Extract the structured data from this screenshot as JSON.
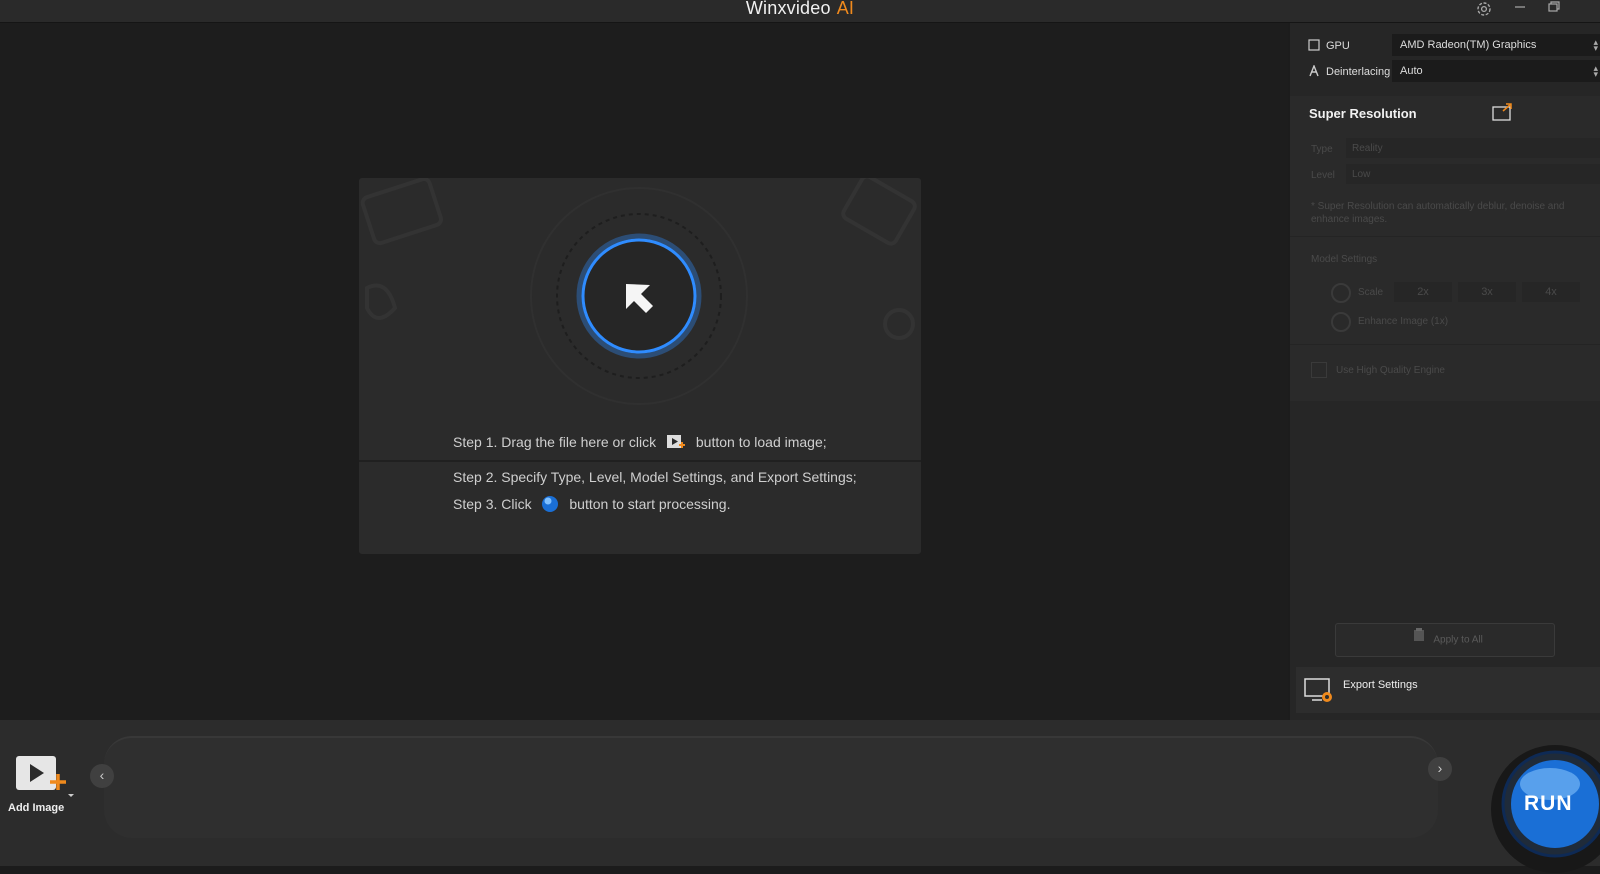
{
  "app": {
    "title": "Winxvideo",
    "title_suffix": "AI"
  },
  "dropzone": {
    "step1_prefix": "Step 1. Drag the file here or click",
    "step1_suffix": "button to load image;",
    "step2": "Step 2. Specify Type, Level, Model Settings, and Export Settings;",
    "step3_prefix": "Step 3. Click",
    "step3_suffix": "button to start processing."
  },
  "right_panel": {
    "gpu": {
      "label": "GPU",
      "value": "AMD Radeon(TM) Graphics"
    },
    "deinterlacing": {
      "label": "Deinterlacing",
      "value": "Auto"
    },
    "super_resolution": {
      "title": "Super Resolution",
      "type_label": "Type",
      "type_value": "Reality",
      "level_label": "Level",
      "level_value": "Low",
      "note": "* Super Resolution can automatically deblur, denoise and enhance images.",
      "model_settings_label": "Model Settings",
      "scale_label": "Scale",
      "scale_options": [
        "2x",
        "3x",
        "4x"
      ],
      "enhance_label": "Enhance Image (1x)",
      "hq_engine_label": "Use High Quality Engine"
    },
    "apply_all_label": "Apply to All",
    "export_settings_label": "Export Settings"
  },
  "bottom": {
    "add_image_label": "Add Image",
    "run_label": "RUN"
  },
  "colors": {
    "accent_orange": "#f08a1d",
    "ring_blue": "#2f8cff",
    "run_blue": "#1a6fd6"
  },
  "icons": [
    "settings-icon",
    "minimize-icon",
    "restore-icon",
    "cursor-arrow-icon",
    "add-image-icon",
    "run-ball-icon",
    "gpu-chip-icon",
    "deinterlace-icon",
    "expand-icon",
    "apply-icon",
    "export-settings-icon",
    "chevron-left-icon",
    "chevron-right-icon"
  ]
}
